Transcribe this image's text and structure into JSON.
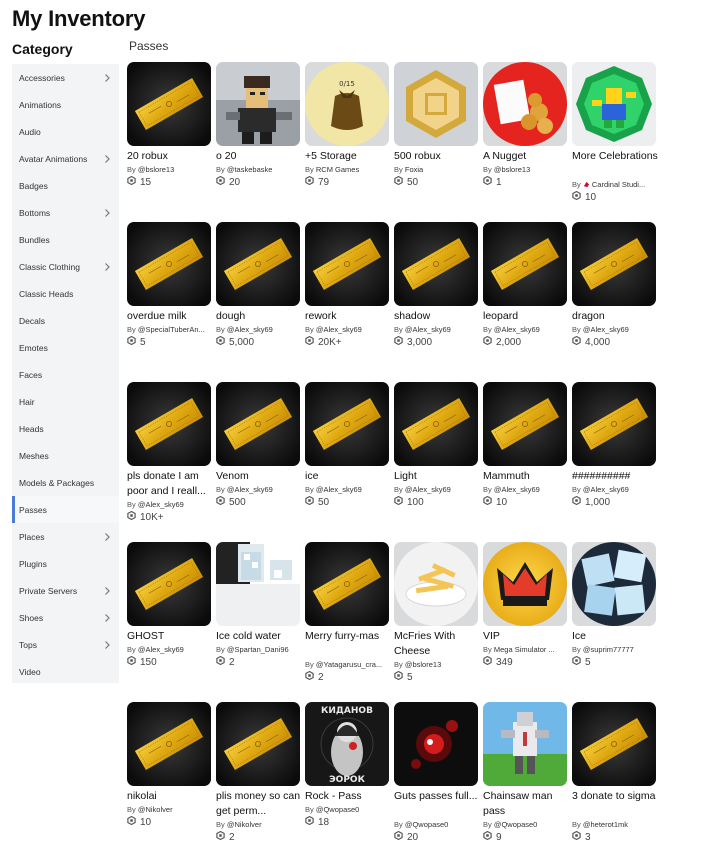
{
  "header": {
    "title": "My Inventory",
    "category_label": "Category",
    "section_title": "Passes"
  },
  "sidebar": {
    "items": [
      {
        "label": "Accessories",
        "chevron": true
      },
      {
        "label": "Animations",
        "chevron": false
      },
      {
        "label": "Audio",
        "chevron": false
      },
      {
        "label": "Avatar Animations",
        "chevron": true
      },
      {
        "label": "Badges",
        "chevron": false
      },
      {
        "label": "Bottoms",
        "chevron": true
      },
      {
        "label": "Bundles",
        "chevron": false
      },
      {
        "label": "Classic Clothing",
        "chevron": true
      },
      {
        "label": "Classic Heads",
        "chevron": false
      },
      {
        "label": "Decals",
        "chevron": false
      },
      {
        "label": "Emotes",
        "chevron": false
      },
      {
        "label": "Faces",
        "chevron": false
      },
      {
        "label": "Hair",
        "chevron": false
      },
      {
        "label": "Heads",
        "chevron": false
      },
      {
        "label": "Meshes",
        "chevron": false
      },
      {
        "label": "Models & Packages",
        "chevron": false
      },
      {
        "label": "Passes",
        "chevron": false,
        "active": true
      },
      {
        "label": "Places",
        "chevron": true
      },
      {
        "label": "Plugins",
        "chevron": false
      },
      {
        "label": "Private Servers",
        "chevron": true
      },
      {
        "label": "Shoes",
        "chevron": true
      },
      {
        "label": "Tops",
        "chevron": true
      },
      {
        "label": "Video",
        "chevron": false
      }
    ]
  },
  "items": [
    {
      "name": "20 robux",
      "by": "By",
      "creator": "@bslore13",
      "price": "15",
      "thumb": "ticket-icon"
    },
    {
      "name": "o 20",
      "by": "By",
      "creator": "@taskebaske",
      "price": "20",
      "thumb": "avatar-image"
    },
    {
      "name": "+5 Storage",
      "by": "By",
      "creator": "RCM Games",
      "price": "79",
      "thumb": "storage-bag-image",
      "thumb_text": "0/15"
    },
    {
      "name": "500 robux",
      "by": "By",
      "creator": "Foxia",
      "price": "50",
      "thumb": "robux-logo-image"
    },
    {
      "name": "A Nugget",
      "by": "By",
      "creator": "@bslore13",
      "price": "1",
      "thumb": "nuggets-image"
    },
    {
      "name": "More Celebrations",
      "by": "By",
      "creator": "Cardinal Studi...",
      "creator_icon": "cardinal-bird-icon",
      "price": "10",
      "thumb": "celebration-badge-image"
    },
    {
      "name": "overdue milk",
      "by": "By",
      "creator": "@SpecialTuberAn...",
      "price": "5",
      "thumb": "ticket-icon"
    },
    {
      "name": "dough",
      "by": "By",
      "creator": "@Alex_sky69",
      "price": "5,000",
      "thumb": "ticket-icon"
    },
    {
      "name": "rework",
      "by": "By",
      "creator": "@Alex_sky69",
      "price": "20K+",
      "thumb": "ticket-icon"
    },
    {
      "name": "shadow",
      "by": "By",
      "creator": "@Alex_sky69",
      "price": "3,000",
      "thumb": "ticket-icon"
    },
    {
      "name": "leopard",
      "by": "By",
      "creator": "@Alex_sky69",
      "price": "2,000",
      "thumb": "ticket-icon"
    },
    {
      "name": "dragon",
      "by": "By",
      "creator": "@Alex_sky69",
      "price": "4,000",
      "thumb": "ticket-icon"
    },
    {
      "name": "pls donate I am poor and I reall...",
      "by": "By",
      "creator": "@Alex_sky69",
      "price": "10K+",
      "thumb": "ticket-icon"
    },
    {
      "name": "Venom",
      "by": "By",
      "creator": "@Alex_sky69",
      "price": "500",
      "thumb": "ticket-icon"
    },
    {
      "name": "ice",
      "by": "By",
      "creator": "@Alex_sky69",
      "price": "50",
      "thumb": "ticket-icon"
    },
    {
      "name": "Light",
      "by": "By",
      "creator": "@Alex_sky69",
      "price": "100",
      "thumb": "ticket-icon"
    },
    {
      "name": "Mammuth",
      "by": "By",
      "creator": "@Alex_sky69",
      "price": "10",
      "thumb": "ticket-icon"
    },
    {
      "name": "##########",
      "by": "By",
      "creator": "@Alex_sky69",
      "price": "1,000",
      "thumb": "ticket-icon"
    },
    {
      "name": "GHOST",
      "by": "By",
      "creator": "@Alex_sky69",
      "price": "150",
      "thumb": "ticket-icon"
    },
    {
      "name": "Ice cold water",
      "by": "By",
      "creator": "@Spartan_Dani96",
      "price": "2",
      "thumb": "ice-water-image"
    },
    {
      "name": "Merry furry-mas",
      "by": "By",
      "creator": "@Yatagarusu_cra...",
      "price": "2",
      "thumb": "ticket-icon"
    },
    {
      "name": "McFries With Cheese",
      "by": "By",
      "creator": "@bslore13",
      "price": "5",
      "thumb": "fries-image"
    },
    {
      "name": "VIP",
      "by": "By",
      "creator": "Mega Simulator ...",
      "price": "349",
      "thumb": "crown-image"
    },
    {
      "name": "Ice",
      "by": "By",
      "creator": "@suprim77777",
      "price": "5",
      "thumb": "ice-cubes-image"
    },
    {
      "name": "nikolai",
      "by": "By",
      "creator": "@Nikolver",
      "price": "10",
      "thumb": "ticket-icon"
    },
    {
      "name": "plis money so can get perm...",
      "by": "By",
      "creator": "@Nikolver",
      "price": "2",
      "thumb": "ticket-icon"
    },
    {
      "name": "Rock - Pass",
      "by": "By",
      "creator": "@Qwopase0",
      "price": "18",
      "thumb": "rock-singer-image",
      "thumb_top": "КИДАНОВ",
      "thumb_bottom": "ЭОРОК"
    },
    {
      "name": "Guts passes full...",
      "by": "By",
      "creator": "@Qwopase0",
      "price": "20",
      "thumb": "guts-image"
    },
    {
      "name": "Chainsaw man pass",
      "by": "By",
      "creator": "@Qwopase0",
      "price": "9",
      "thumb": "chainsaw-man-image"
    },
    {
      "name": "3 donate to sigma",
      "by": "By",
      "creator": "@heterot1mk",
      "price": "3",
      "thumb": "ticket-icon"
    }
  ]
}
